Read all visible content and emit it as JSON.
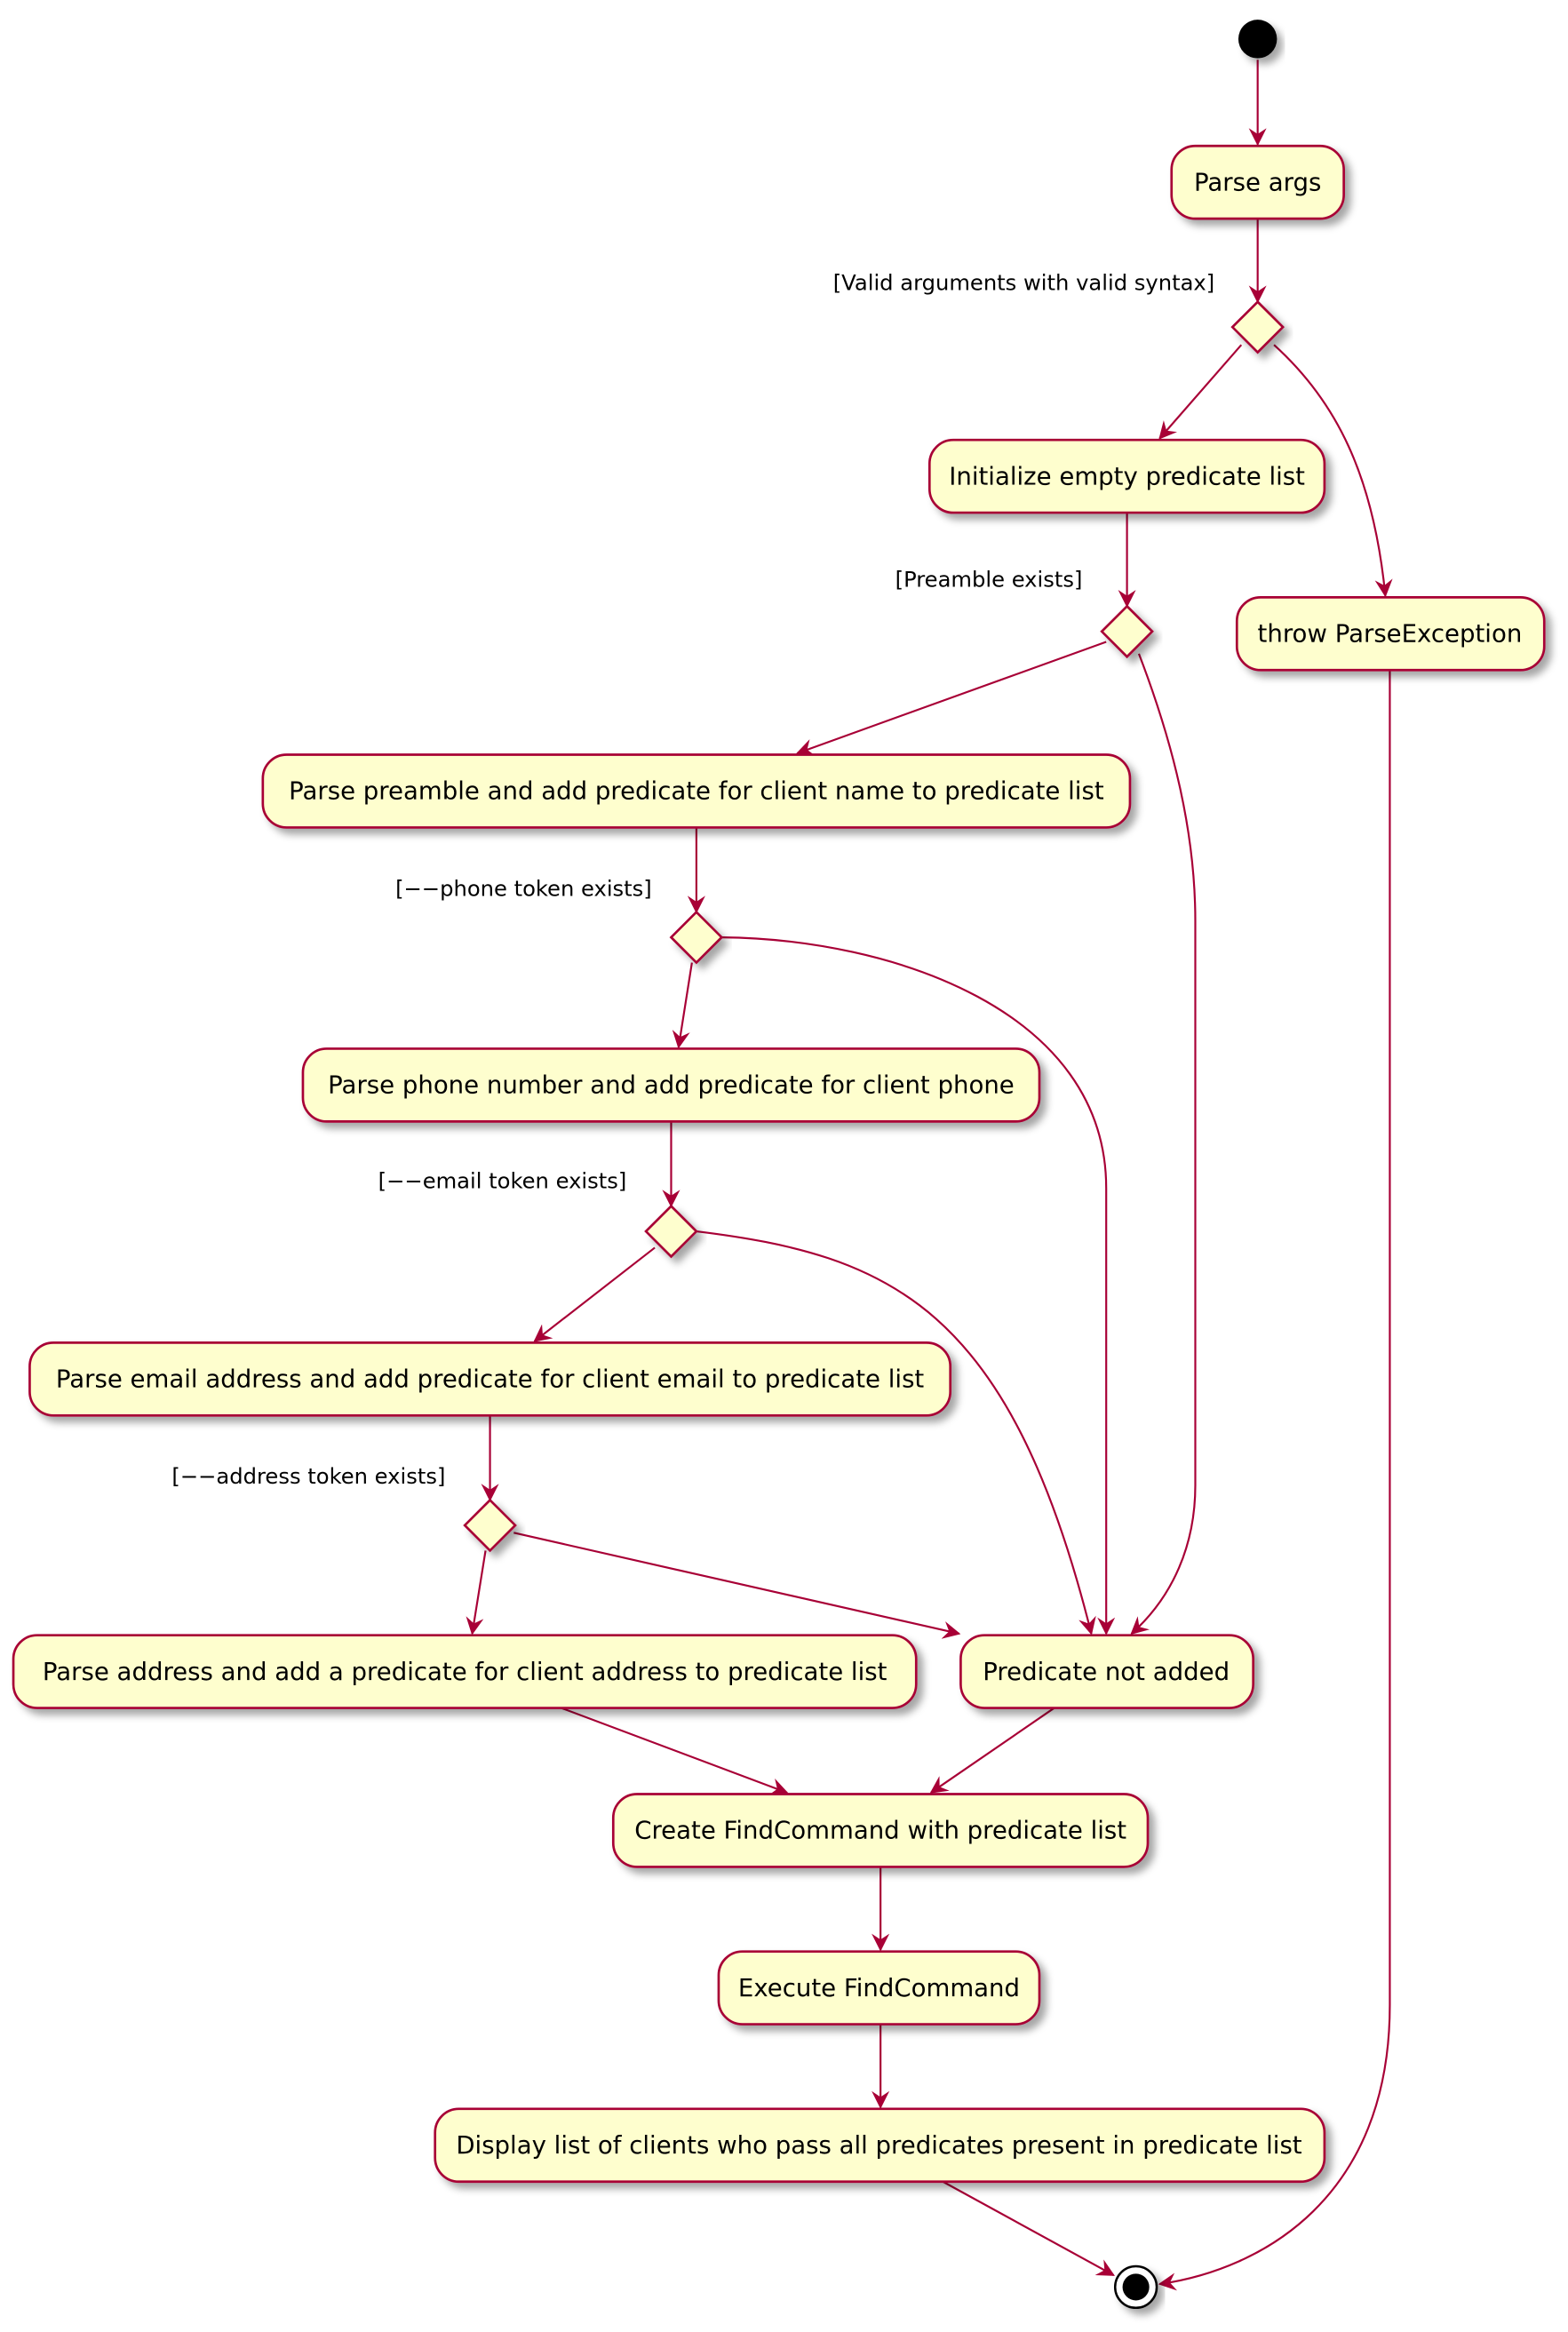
{
  "colors": {
    "border": "#A80036",
    "fill": "#FEFECE",
    "text": "#000000"
  },
  "nodes": {
    "parse_args": "Parse args",
    "init_list": "Initialize empty predicate list",
    "throw": "throw ParseException",
    "parse_preamble": "Parse preamble and add predicate for client name to predicate list",
    "parse_phone": "Parse phone number and add predicate for client phone",
    "parse_email": "Parse email address and add predicate for client email to predicate list",
    "parse_address": "Parse address and add a predicate for client address to predicate list",
    "not_added": "Predicate not added",
    "create_cmd": "Create FindCommand with predicate list",
    "execute_cmd": "Execute FindCommand",
    "display": "Display list of clients who pass all predicates present in predicate list"
  },
  "guards": {
    "valid_args": "[Valid arguments with valid syntax]",
    "preamble": "[Preamble exists]",
    "phone": "[−−phone token exists]",
    "email": "[−−email token exists]",
    "address": "[−−address token exists]"
  }
}
